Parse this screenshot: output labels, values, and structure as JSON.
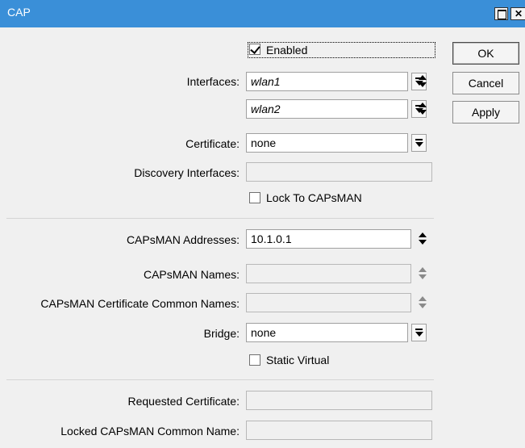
{
  "window": {
    "title": "CAP",
    "close_glyph": "✕"
  },
  "form": {
    "enabled_label": "Enabled",
    "enabled_checked": true,
    "interfaces_label": "Interfaces:",
    "interface_1": "wlan1",
    "interface_2": "wlan2",
    "certificate_label": "Certificate:",
    "certificate_value": "none",
    "discovery_label": "Discovery Interfaces:",
    "discovery_value": "",
    "lock_label": "Lock To CAPsMAN",
    "lock_checked": false,
    "capsman_addresses_label": "CAPsMAN Addresses:",
    "capsman_addresses_value": "10.1.0.1",
    "capsman_names_label": "CAPsMAN Names:",
    "capsman_names_value": "",
    "capsman_cert_cn_label": "CAPsMAN Certificate Common Names:",
    "capsman_cert_cn_value": "",
    "bridge_label": "Bridge:",
    "bridge_value": "none",
    "static_virtual_label": "Static Virtual",
    "static_virtual_checked": false,
    "requested_cert_label": "Requested Certificate:",
    "requested_cert_value": "",
    "locked_cn_label": "Locked CAPsMAN Common Name:",
    "locked_cn_value": ""
  },
  "buttons": {
    "ok": "OK",
    "cancel": "Cancel",
    "apply": "Apply"
  }
}
